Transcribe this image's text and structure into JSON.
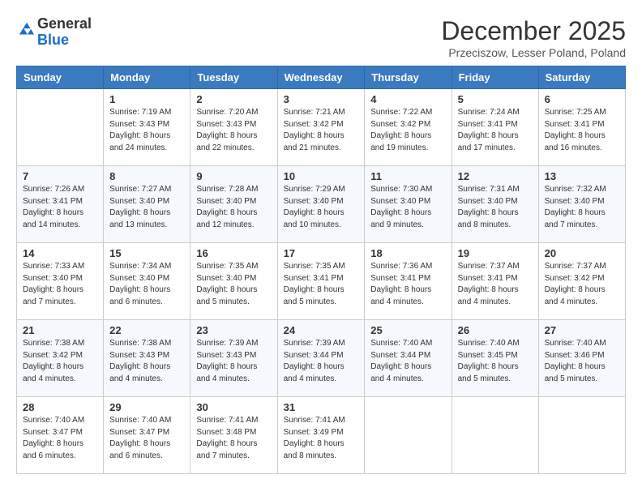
{
  "header": {
    "logo_line1": "General",
    "logo_line2": "Blue",
    "month_title": "December 2025",
    "location": "Przeciszow, Lesser Poland, Poland"
  },
  "weekdays": [
    "Sunday",
    "Monday",
    "Tuesday",
    "Wednesday",
    "Thursday",
    "Friday",
    "Saturday"
  ],
  "weeks": [
    [
      {
        "date": "",
        "empty": true
      },
      {
        "date": "1",
        "sunrise": "7:19 AM",
        "sunset": "3:43 PM",
        "daylight": "8 hours and 24 minutes."
      },
      {
        "date": "2",
        "sunrise": "7:20 AM",
        "sunset": "3:43 PM",
        "daylight": "8 hours and 22 minutes."
      },
      {
        "date": "3",
        "sunrise": "7:21 AM",
        "sunset": "3:42 PM",
        "daylight": "8 hours and 21 minutes."
      },
      {
        "date": "4",
        "sunrise": "7:22 AM",
        "sunset": "3:42 PM",
        "daylight": "8 hours and 19 minutes."
      },
      {
        "date": "5",
        "sunrise": "7:24 AM",
        "sunset": "3:41 PM",
        "daylight": "8 hours and 17 minutes."
      },
      {
        "date": "6",
        "sunrise": "7:25 AM",
        "sunset": "3:41 PM",
        "daylight": "8 hours and 16 minutes."
      }
    ],
    [
      {
        "date": "7",
        "sunrise": "7:26 AM",
        "sunset": "3:41 PM",
        "daylight": "8 hours and 14 minutes."
      },
      {
        "date": "8",
        "sunrise": "7:27 AM",
        "sunset": "3:40 PM",
        "daylight": "8 hours and 13 minutes."
      },
      {
        "date": "9",
        "sunrise": "7:28 AM",
        "sunset": "3:40 PM",
        "daylight": "8 hours and 12 minutes."
      },
      {
        "date": "10",
        "sunrise": "7:29 AM",
        "sunset": "3:40 PM",
        "daylight": "8 hours and 10 minutes."
      },
      {
        "date": "11",
        "sunrise": "7:30 AM",
        "sunset": "3:40 PM",
        "daylight": "8 hours and 9 minutes."
      },
      {
        "date": "12",
        "sunrise": "7:31 AM",
        "sunset": "3:40 PM",
        "daylight": "8 hours and 8 minutes."
      },
      {
        "date": "13",
        "sunrise": "7:32 AM",
        "sunset": "3:40 PM",
        "daylight": "8 hours and 7 minutes."
      }
    ],
    [
      {
        "date": "14",
        "sunrise": "7:33 AM",
        "sunset": "3:40 PM",
        "daylight": "8 hours and 7 minutes."
      },
      {
        "date": "15",
        "sunrise": "7:34 AM",
        "sunset": "3:40 PM",
        "daylight": "8 hours and 6 minutes."
      },
      {
        "date": "16",
        "sunrise": "7:35 AM",
        "sunset": "3:40 PM",
        "daylight": "8 hours and 5 minutes."
      },
      {
        "date": "17",
        "sunrise": "7:35 AM",
        "sunset": "3:41 PM",
        "daylight": "8 hours and 5 minutes."
      },
      {
        "date": "18",
        "sunrise": "7:36 AM",
        "sunset": "3:41 PM",
        "daylight": "8 hours and 4 minutes."
      },
      {
        "date": "19",
        "sunrise": "7:37 AM",
        "sunset": "3:41 PM",
        "daylight": "8 hours and 4 minutes."
      },
      {
        "date": "20",
        "sunrise": "7:37 AM",
        "sunset": "3:42 PM",
        "daylight": "8 hours and 4 minutes."
      }
    ],
    [
      {
        "date": "21",
        "sunrise": "7:38 AM",
        "sunset": "3:42 PM",
        "daylight": "8 hours and 4 minutes."
      },
      {
        "date": "22",
        "sunrise": "7:38 AM",
        "sunset": "3:43 PM",
        "daylight": "8 hours and 4 minutes."
      },
      {
        "date": "23",
        "sunrise": "7:39 AM",
        "sunset": "3:43 PM",
        "daylight": "8 hours and 4 minutes."
      },
      {
        "date": "24",
        "sunrise": "7:39 AM",
        "sunset": "3:44 PM",
        "daylight": "8 hours and 4 minutes."
      },
      {
        "date": "25",
        "sunrise": "7:40 AM",
        "sunset": "3:44 PM",
        "daylight": "8 hours and 4 minutes."
      },
      {
        "date": "26",
        "sunrise": "7:40 AM",
        "sunset": "3:45 PM",
        "daylight": "8 hours and 5 minutes."
      },
      {
        "date": "27",
        "sunrise": "7:40 AM",
        "sunset": "3:46 PM",
        "daylight": "8 hours and 5 minutes."
      }
    ],
    [
      {
        "date": "28",
        "sunrise": "7:40 AM",
        "sunset": "3:47 PM",
        "daylight": "8 hours and 6 minutes."
      },
      {
        "date": "29",
        "sunrise": "7:40 AM",
        "sunset": "3:47 PM",
        "daylight": "8 hours and 6 minutes."
      },
      {
        "date": "30",
        "sunrise": "7:41 AM",
        "sunset": "3:48 PM",
        "daylight": "8 hours and 7 minutes."
      },
      {
        "date": "31",
        "sunrise": "7:41 AM",
        "sunset": "3:49 PM",
        "daylight": "8 hours and 8 minutes."
      },
      {
        "date": "",
        "empty": true
      },
      {
        "date": "",
        "empty": true
      },
      {
        "date": "",
        "empty": true
      }
    ]
  ],
  "labels": {
    "sunrise": "Sunrise:",
    "sunset": "Sunset:",
    "daylight": "Daylight:"
  }
}
